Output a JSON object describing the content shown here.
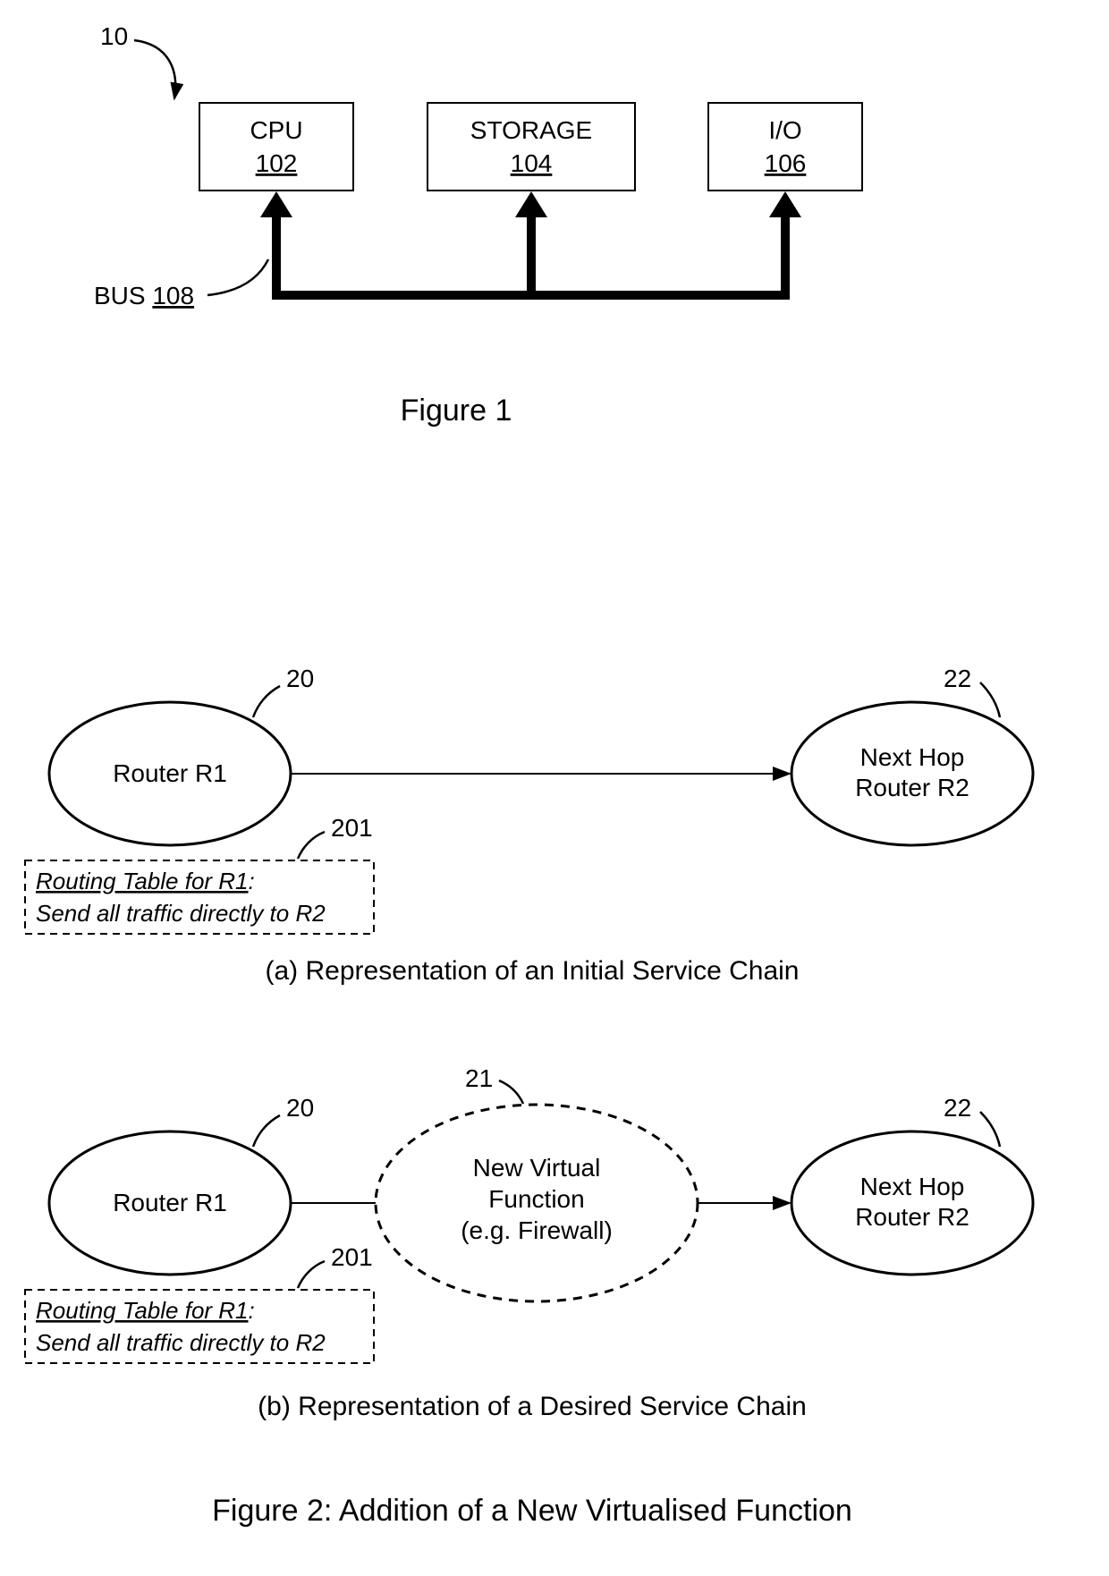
{
  "fig1": {
    "ref": "10",
    "cpu": {
      "label": "CPU",
      "num": "102"
    },
    "storage": {
      "label": "STORAGE",
      "num": "104"
    },
    "io": {
      "label": "I/O",
      "num": "106"
    },
    "bus": {
      "label": "BUS",
      "num": "108"
    },
    "caption": "Figure 1"
  },
  "fig2a": {
    "r1": {
      "label": "Router R1",
      "ref": "20"
    },
    "r2": {
      "line1": "Next Hop",
      "line2": "Router R2",
      "ref": "22"
    },
    "table": {
      "title": "Routing Table for R1",
      "colon": ":",
      "body": "Send all traffic directly to R2",
      "ref": "201"
    },
    "caption": "(a) Representation of an Initial Service Chain"
  },
  "fig2b": {
    "r1": {
      "label": "Router R1",
      "ref": "20"
    },
    "vf": {
      "line1": "New Virtual",
      "line2": "Function",
      "line3": "(e.g. Firewall)",
      "ref": "21"
    },
    "r2": {
      "line1": "Next Hop",
      "line2": "Router R2",
      "ref": "22"
    },
    "table": {
      "title": "Routing Table for R1",
      "colon": ":",
      "body": "Send all traffic directly to R2",
      "ref": "201"
    },
    "caption": "(b) Representation of a Desired Service Chain"
  },
  "fig2": {
    "caption": "Figure 2: Addition of a New Virtualised Function"
  }
}
